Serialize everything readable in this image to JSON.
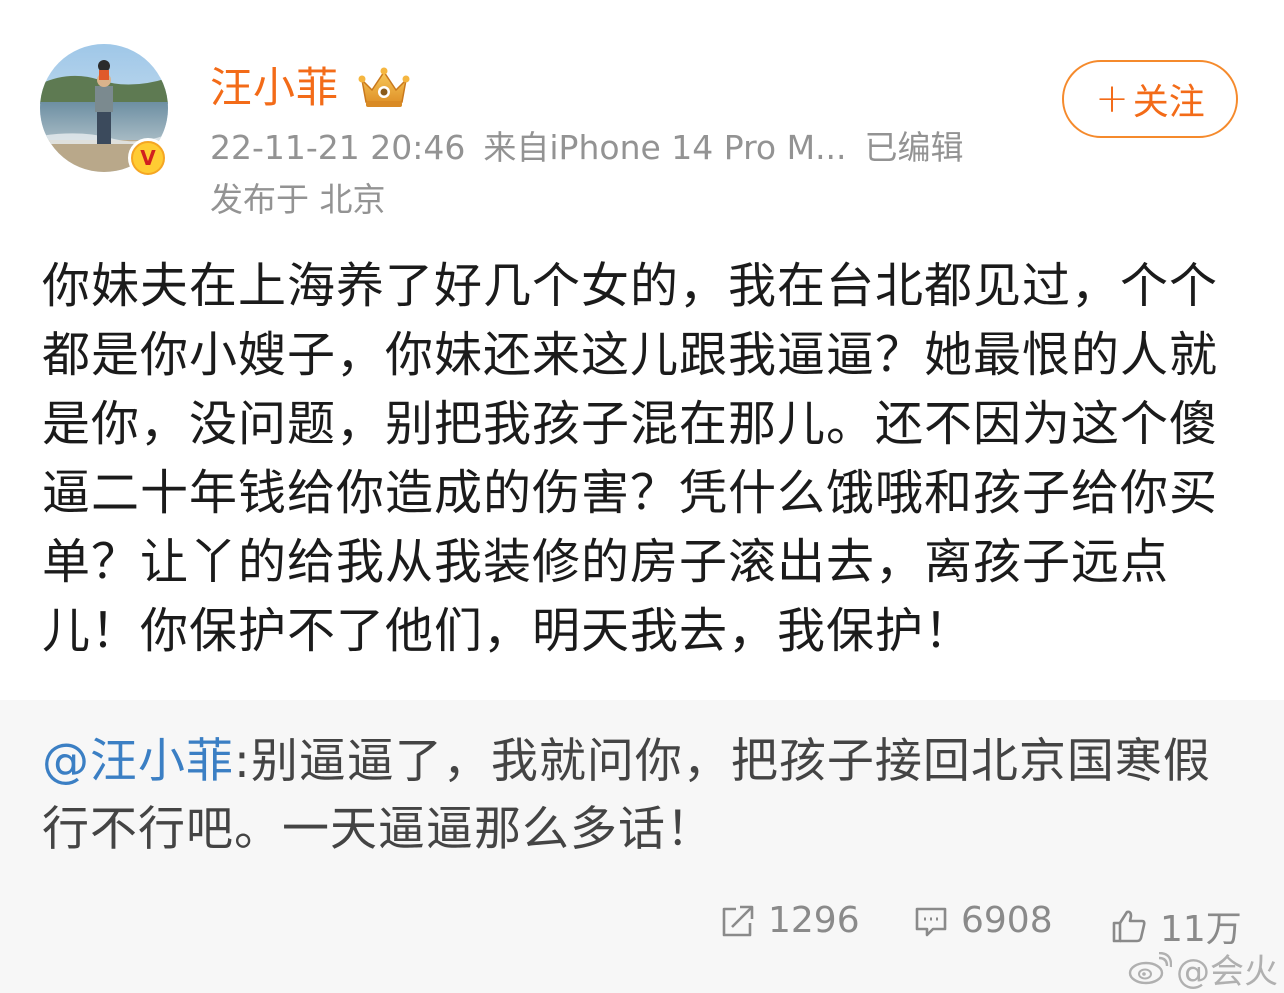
{
  "header": {
    "username": "汪小菲",
    "timestamp": "22-11-21 20:46",
    "source": "来自iPhone 14 Pro M...",
    "edited": "已编辑",
    "location": "发布于 北京",
    "follow_plus": "+",
    "follow_label": "关注",
    "verified_mark": "V"
  },
  "post": {
    "text": "你妹夫在上海养了好几个女的，我在台北都见过，个个都是你小嫂子，你妹还来这儿跟我逼逼？她最恨的人就是你，没问题，别把我孩子混在那儿。还不因为这个傻逼二十年钱给你造成的伤害？凭什么饿哦和孩子给你买单？让丫的给我从我装修的房子滚出去，离孩子远点儿！你保护不了他们，明天我去，我保护！"
  },
  "retweet": {
    "mention": "@汪小菲",
    "text": ":别逼逼了，我就问你，把孩子接回北京国寒假行不行吧。一天逼逼那么多话！"
  },
  "actions": {
    "reposts": "1296",
    "comments": "6908",
    "likes": "11万"
  },
  "watermark": {
    "text": "@会火"
  },
  "icons": {
    "crown": "crown-icon",
    "repost": "repost-icon",
    "comment": "comment-icon",
    "like": "like-icon",
    "weibo": "weibo-logo-icon"
  },
  "colors": {
    "username": "#f36b18",
    "mention": "#3b7fc4",
    "meta": "#939393",
    "retweet_bg": "#f7f7f7",
    "follow_border": "#f58a2c"
  }
}
